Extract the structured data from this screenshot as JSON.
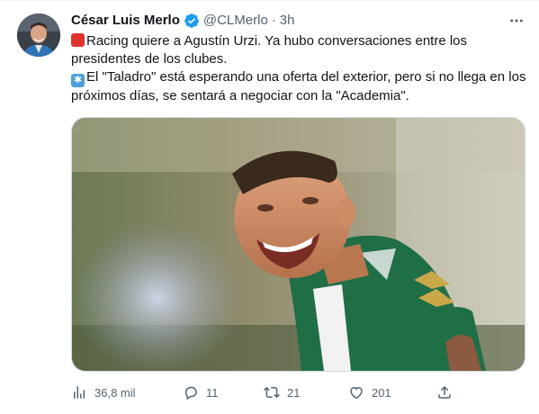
{
  "author": {
    "name": "César Luis Merlo",
    "handle": "@CLMerlo",
    "separator": "·",
    "time": "3h",
    "verified": true
  },
  "tweet": {
    "line1": "Racing quiere a Agustín Urzi. Ya hubo conversaciones entre los presidentes de los clubes.",
    "line2": "El \"Taladro\" está esperando una oferta del exterior, pero si no llega en los próximos días, se sentará a negociar con la \"Academia\".",
    "emoji1": "siren-emoji",
    "emoji2": "asterisk-emoji"
  },
  "actions": {
    "views": "36,8 mil",
    "replies": "11",
    "retweets": "21",
    "likes": "201"
  },
  "colors": {
    "verified": "#1d9bf0",
    "text": "#0f1419",
    "muted": "#536471",
    "jersey_green": "#1f6e46"
  },
  "icons": [
    "more-icon",
    "verified-badge-icon",
    "views-icon",
    "reply-icon",
    "retweet-icon",
    "like-icon",
    "share-icon"
  ]
}
